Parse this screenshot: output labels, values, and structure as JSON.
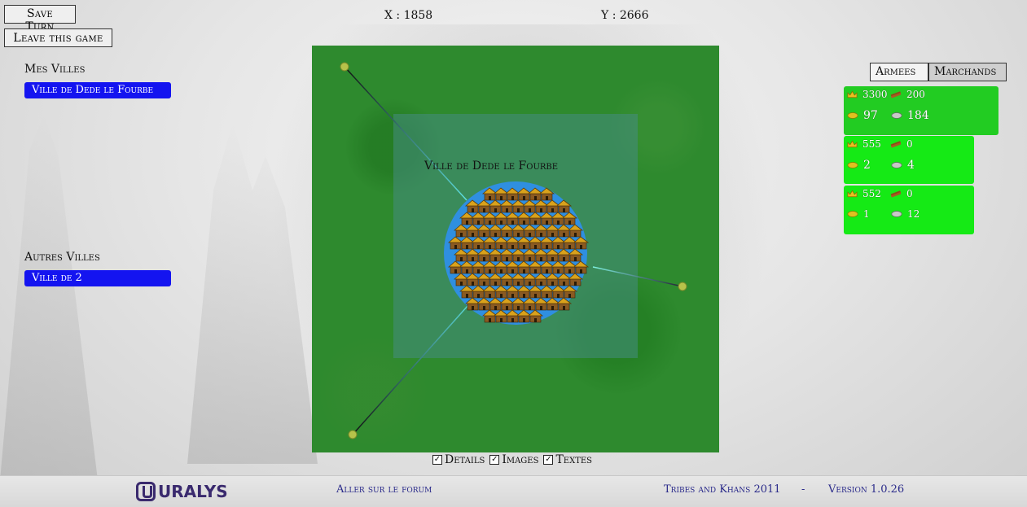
{
  "controls": {
    "save_turn": "Save Turn",
    "leave_game": "Leave this game"
  },
  "coords": {
    "x_label": "X : 1858",
    "y_label": "Y : 2666"
  },
  "left_panel": {
    "mes_villes_title": "Mes Villes",
    "mes_villes": [
      "Ville de Dede le Fourbe"
    ],
    "autres_villes_title": "Autres Villes",
    "autres_villes": [
      "Ville de 2"
    ]
  },
  "map": {
    "city_label": "Ville de Dede le Fourbe",
    "colors": {
      "grass": "#2e8a2e",
      "zone": "#4f9e8a",
      "city_disc": "#2f8fe0",
      "waypoint": "#b7c24a"
    }
  },
  "toggles": {
    "details": "Details",
    "images": "Images",
    "textes": "Textes"
  },
  "tabs": {
    "armees": "Armees",
    "marchands": "Marchands"
  },
  "merchants": [
    {
      "gold": "3300",
      "wood": "200",
      "food": "97",
      "stone": "184",
      "icons": [
        "crown-icon",
        "wood-icon",
        "food-icon",
        "stone-icon"
      ]
    },
    {
      "gold": "555",
      "wood": "0",
      "food": "2",
      "stone": "4",
      "icons": [
        "crown-icon",
        "wood-icon",
        "food-icon",
        "stone-icon"
      ]
    },
    {
      "gold": "552",
      "wood": "0",
      "food": "1",
      "stone": "12",
      "icons": [
        "crown-icon",
        "wood-icon",
        "food-icon",
        "stone-icon"
      ]
    }
  ],
  "footer": {
    "logo": "URALYS",
    "forum_link": "Aller sur le forum",
    "credits": "Tribes and Khans 2011",
    "separator": "-",
    "version": "Version 1.0.26"
  }
}
